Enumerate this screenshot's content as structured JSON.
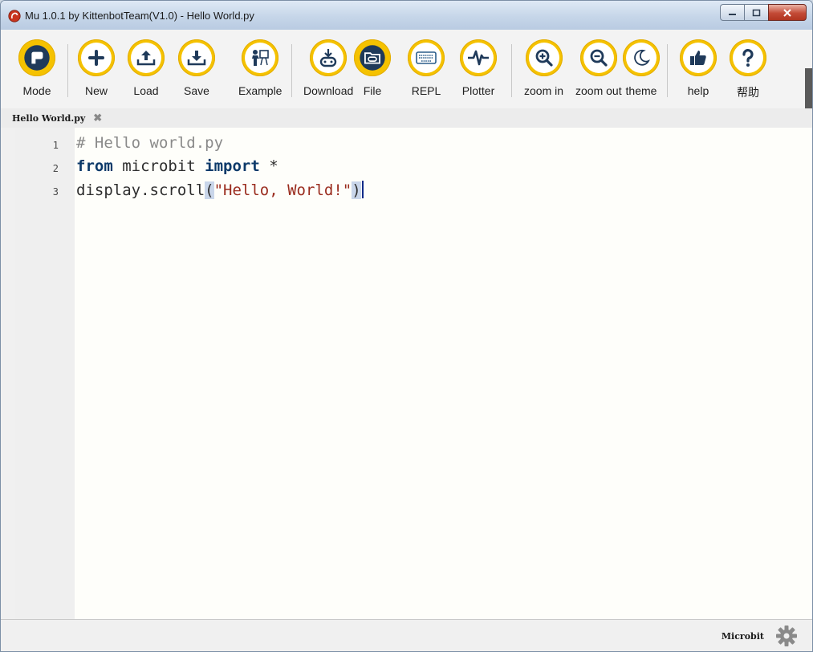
{
  "window": {
    "title": "Mu 1.0.1 by KittenbotTeam(V1.0) - Hello World.py"
  },
  "toolbar": {
    "buttons": [
      {
        "label": "Mode",
        "icon": "mode-icon"
      },
      {
        "label": "New",
        "icon": "plus-icon"
      },
      {
        "label": "Load",
        "icon": "upload-icon"
      },
      {
        "label": "Save",
        "icon": "download-icon"
      },
      {
        "label": "Example",
        "icon": "presenter-icon"
      },
      {
        "label": "Download",
        "icon": "flash-download-icon"
      },
      {
        "label": "File",
        "icon": "files-icon"
      },
      {
        "label": "REPL",
        "icon": "keyboard-icon"
      },
      {
        "label": "Plotter",
        "icon": "pulse-icon"
      },
      {
        "label": "zoom in",
        "icon": "zoom-in-icon"
      },
      {
        "label": "zoom out",
        "icon": "zoom-out-icon"
      },
      {
        "label": "theme",
        "icon": "moon-icon"
      },
      {
        "label": "help",
        "icon": "thumbs-up-icon"
      },
      {
        "label": "帮助",
        "icon": "question-icon"
      }
    ]
  },
  "tabs": [
    {
      "label": "Hello World.py",
      "close": "✖"
    }
  ],
  "editor": {
    "lines": [
      {
        "num": "1",
        "parts": [
          {
            "t": "# Hello world.py",
            "c": "cm"
          }
        ]
      },
      {
        "num": "2",
        "parts": [
          {
            "t": "from",
            "c": "kw"
          },
          {
            "t": " microbit ",
            "c": ""
          },
          {
            "t": "import",
            "c": "kw"
          },
          {
            "t": " *",
            "c": ""
          }
        ]
      },
      {
        "num": "3",
        "parts": [
          {
            "t": "display.scroll",
            "c": ""
          },
          {
            "t": "(",
            "c": "br"
          },
          {
            "t": "\"Hello, World!\"",
            "c": "st"
          },
          {
            "t": ")",
            "c": "br"
          }
        ]
      }
    ]
  },
  "status": {
    "mode": "Microbit"
  },
  "colors": {
    "button_ring": "#f5c200",
    "icon_dark": "#1f3a5a",
    "keyword": "#0d3a6a",
    "string": "#9a2c1e",
    "comment": "#8a8a8a"
  }
}
